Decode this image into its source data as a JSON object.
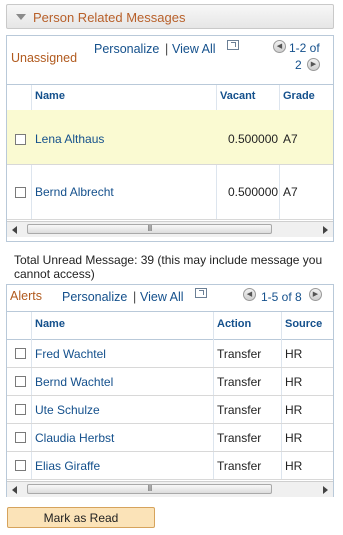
{
  "section": {
    "title": "Person Related Messages"
  },
  "unassigned": {
    "caption": "Unassigned",
    "personalize": "Personalize",
    "sep": "|",
    "view_all": "View All",
    "range_line1": "1-2 of",
    "range_line2": "2",
    "columns": [
      "Name",
      "Vacant",
      "Grade"
    ],
    "rows": [
      {
        "name": "Lena Althaus",
        "vacant": "0.500000",
        "grade": "A7"
      },
      {
        "name": "Bernd Albrecht",
        "vacant": "0.500000",
        "grade": "A7"
      }
    ],
    "scroll_thumb": "III"
  },
  "note": "Total Unread Message: 39 (this may include message you cannot access)",
  "alerts": {
    "caption": "Alerts",
    "personalize": "Personalize",
    "sep": "|",
    "view_all": "View All",
    "range": "1-5 of 8",
    "columns": [
      "Name",
      "Action",
      "Source"
    ],
    "rows": [
      {
        "name": "Fred Wachtel",
        "action": "Transfer",
        "source": "HR"
      },
      {
        "name": "Bernd Wachtel",
        "action": "Transfer",
        "source": "HR"
      },
      {
        "name": "Ute Schulze",
        "action": "Transfer",
        "source": "HR"
      },
      {
        "name": "Claudia Herbst",
        "action": "Transfer",
        "source": "HR"
      },
      {
        "name": "Elias Giraffe",
        "action": "Transfer",
        "source": "HR"
      }
    ],
    "scroll_thumb": "III"
  },
  "mark_button": "Mark as Read"
}
